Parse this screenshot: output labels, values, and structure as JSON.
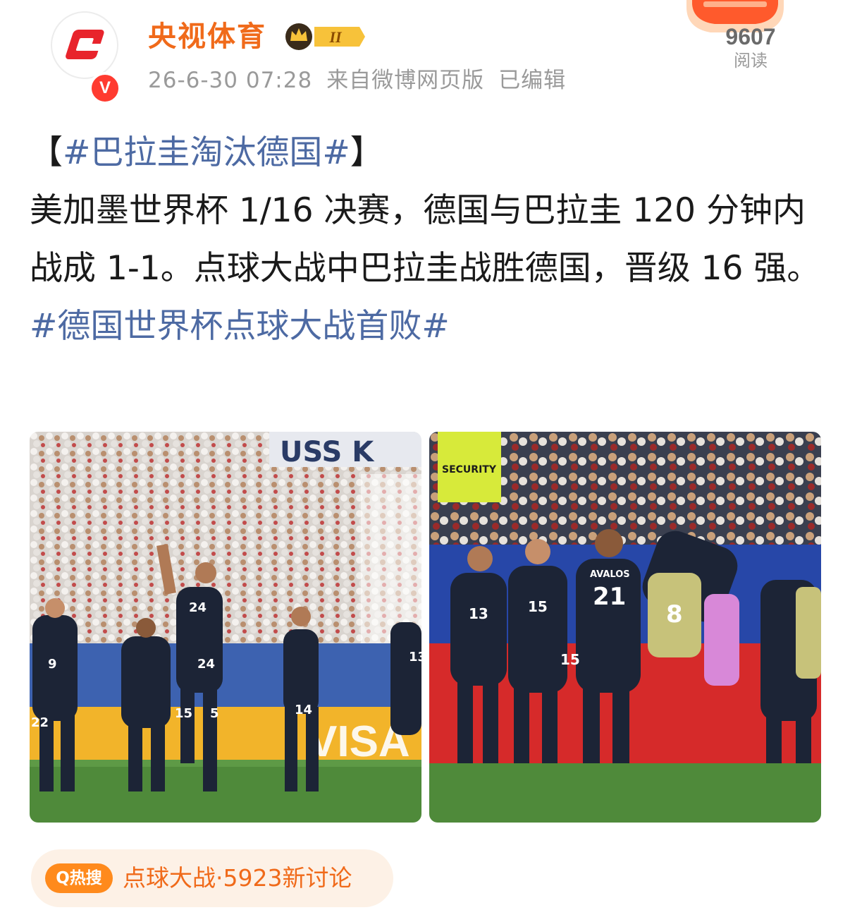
{
  "header": {
    "username": "央视体育",
    "rank_badge": "II",
    "timestamp": "26-6-30 07:28",
    "source": "来自微博网页版",
    "edited": "已编辑",
    "read_count": "9607",
    "read_label": "阅读",
    "avatar_verified_mark": "V"
  },
  "post": {
    "open_bracket": "【",
    "title_hashtag": "#巴拉圭淘汰德国#",
    "close_bracket": "】",
    "body": "美加墨世界杯 1/16 决赛，德国与巴拉圭 120 分钟内战成 1-1。点球大战中巴拉圭战胜德国，晋级 16 强。",
    "tail_hashtag": "#德国世界杯点球大战首败#"
  },
  "photos": [
    {
      "jersey_numbers": [
        "9",
        "24",
        "24",
        "15",
        "5",
        "14",
        "13",
        "22"
      ],
      "board_text": "USS K",
      "ad_text": "VISA"
    },
    {
      "vest_text": "SECURITY",
      "jersey_numbers": [
        "13",
        "15",
        "21",
        "15",
        "8"
      ],
      "player_name": "AVALOS"
    }
  ],
  "hot_search": {
    "tag": "Q热搜",
    "text": "点球大战·5923新讨论"
  },
  "colors": {
    "accent": "#f06a1a",
    "hashtag": "#4d6aa3",
    "muted": "#9a9a9a",
    "hot_tag_bg": "#ff8a1c",
    "hot_pill_bg": "#fdf1e6"
  }
}
